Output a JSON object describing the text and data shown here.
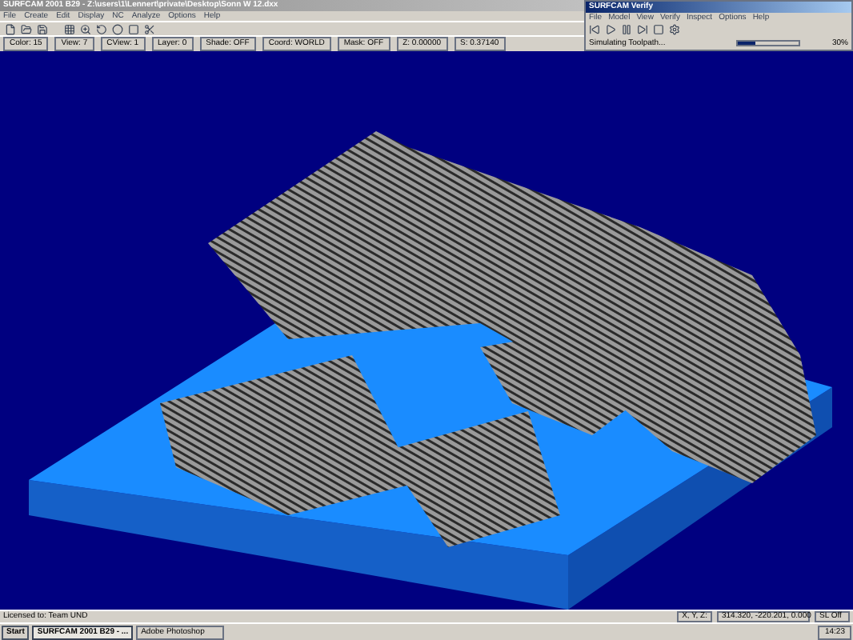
{
  "window": {
    "title": "SURFCAM 2001 B29 - Z:\\users\\1\\Lennert\\private\\Desktop\\Sonn W 12.dxx"
  },
  "menu": [
    "File",
    "Create",
    "Edit",
    "Display",
    "NC",
    "Analyze",
    "Options",
    "Help"
  ],
  "properties": [
    {
      "label": "Color: 15"
    },
    {
      "label": "View: 7"
    },
    {
      "label": "CView: 1"
    },
    {
      "label": "Layer: 0"
    },
    {
      "label": "Shade: OFF"
    },
    {
      "label": "Coord: WORLD"
    },
    {
      "label": "Mask: OFF"
    },
    {
      "label": "Z: 0.00000"
    },
    {
      "label": "S: 0.37140"
    }
  ],
  "verify_window": {
    "title": "SURFCAM Verify",
    "menu": [
      "File",
      "Model",
      "View",
      "Verify",
      "Inspect",
      "Options",
      "Help"
    ],
    "status": "Simulating Toolpath...",
    "level": 0.3,
    "percent": "30%"
  },
  "status_bar": {
    "license": "Licensed to: Team UND",
    "coord_label": "X, Y, Z:",
    "coords": "314.320, -220.201, 0.000",
    "snap": "SL Off"
  },
  "taskbar": {
    "start": "Start",
    "tasks": [
      {
        "label": "SURFCAM 2001 B29 - ...",
        "selected": true
      },
      {
        "label": "Adobe Photoshop",
        "selected": false
      }
    ],
    "clock": "14:23"
  }
}
